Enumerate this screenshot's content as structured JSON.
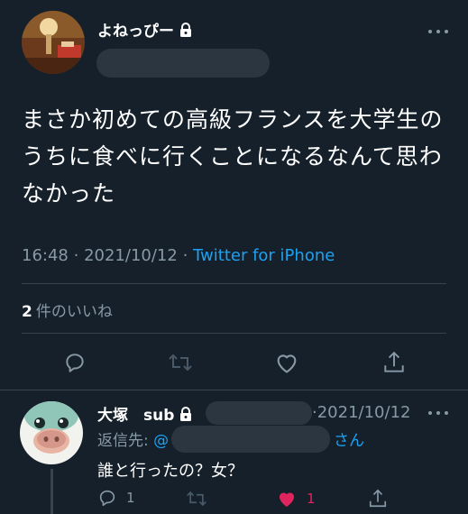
{
  "tweet": {
    "display_name": "よねっぴー",
    "text": "まさか初めての高級フランスを大学生のうちに食べに行くことになるなんて思わなかった",
    "time": "16:48",
    "date": "2021/10/12",
    "separator": "·",
    "source": "Twitter for iPhone",
    "likes_count": "2",
    "likes_label": "件のいいね"
  },
  "reply": {
    "display_name": "大塚　sub",
    "date_sep": "·",
    "date": "2021/10/12",
    "replying_label": "返信先:",
    "mention_prefix": "@",
    "mention_suffix": "さん",
    "text": "誰と行ったの？女？",
    "reply_count": "1",
    "like_count": "1"
  },
  "colors": {
    "background": "#15202b",
    "accent": "#1da1f2",
    "muted": "#8899a6",
    "like": "#e0245e",
    "divider": "#38444d"
  }
}
